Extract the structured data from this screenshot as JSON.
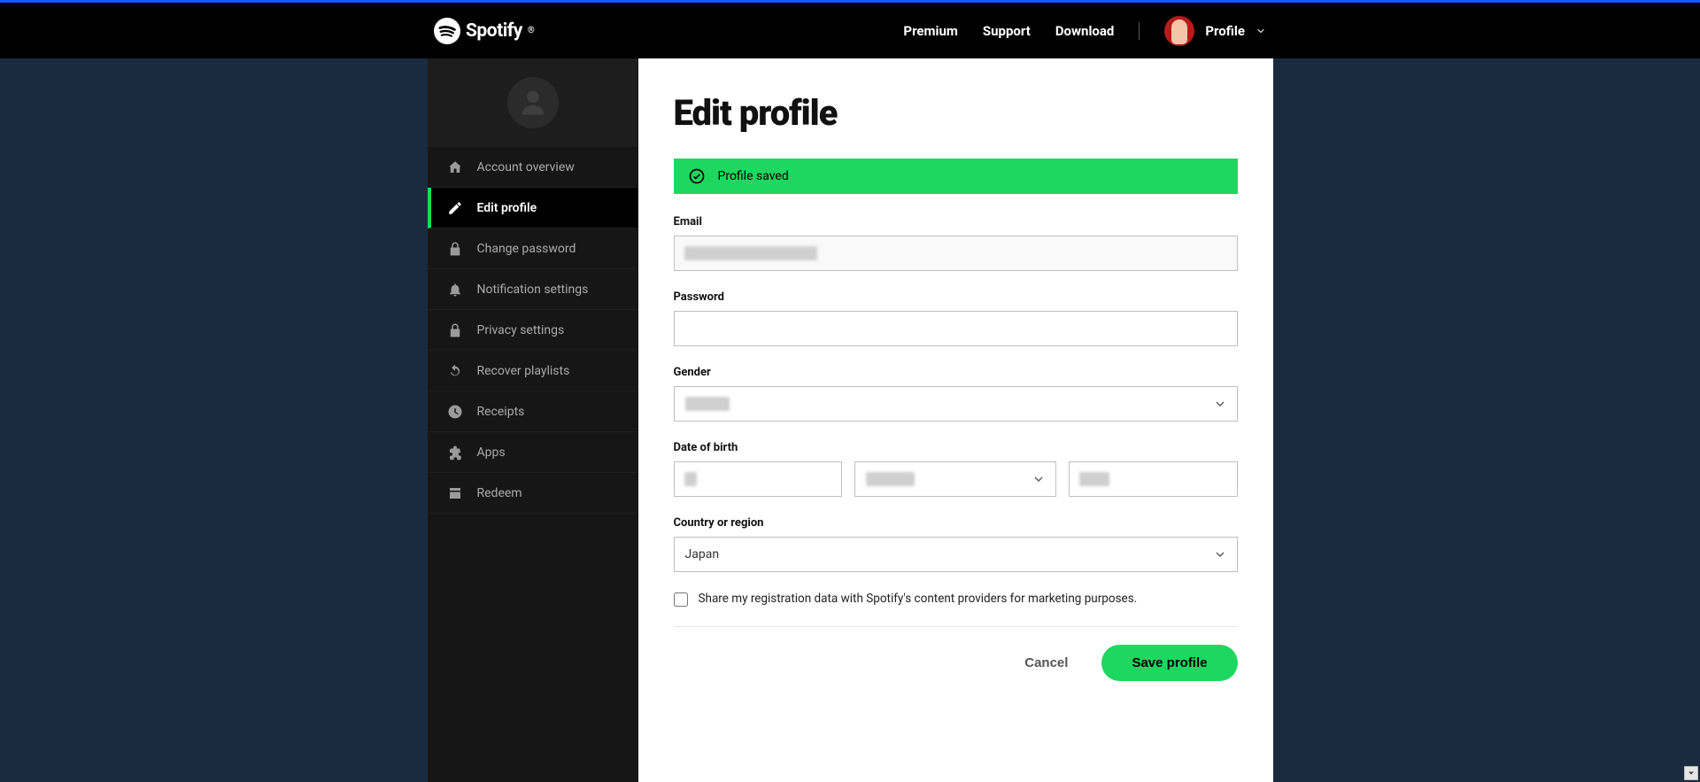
{
  "header": {
    "brand": "Spotify",
    "nav": {
      "premium": "Premium",
      "support": "Support",
      "download": "Download",
      "profile": "Profile"
    }
  },
  "sidebar": {
    "items": [
      {
        "label": "Account overview"
      },
      {
        "label": "Edit profile"
      },
      {
        "label": "Change password"
      },
      {
        "label": "Notification settings"
      },
      {
        "label": "Privacy settings"
      },
      {
        "label": "Recover playlists"
      },
      {
        "label": "Receipts"
      },
      {
        "label": "Apps"
      },
      {
        "label": "Redeem"
      }
    ]
  },
  "content": {
    "title": "Edit profile",
    "alert": "Profile saved",
    "email_label": "Email",
    "email_value": "",
    "password_label": "Password",
    "password_value": "",
    "gender_label": "Gender",
    "gender_value": "",
    "dob_label": "Date of birth",
    "dob_day": "",
    "dob_month": "",
    "dob_year": "",
    "country_label": "Country or region",
    "country_value": "Japan",
    "marketing_checkbox_label": "Share my registration data with Spotify's content providers for marketing purposes.",
    "cancel_label": "Cancel",
    "save_label": "Save profile"
  }
}
